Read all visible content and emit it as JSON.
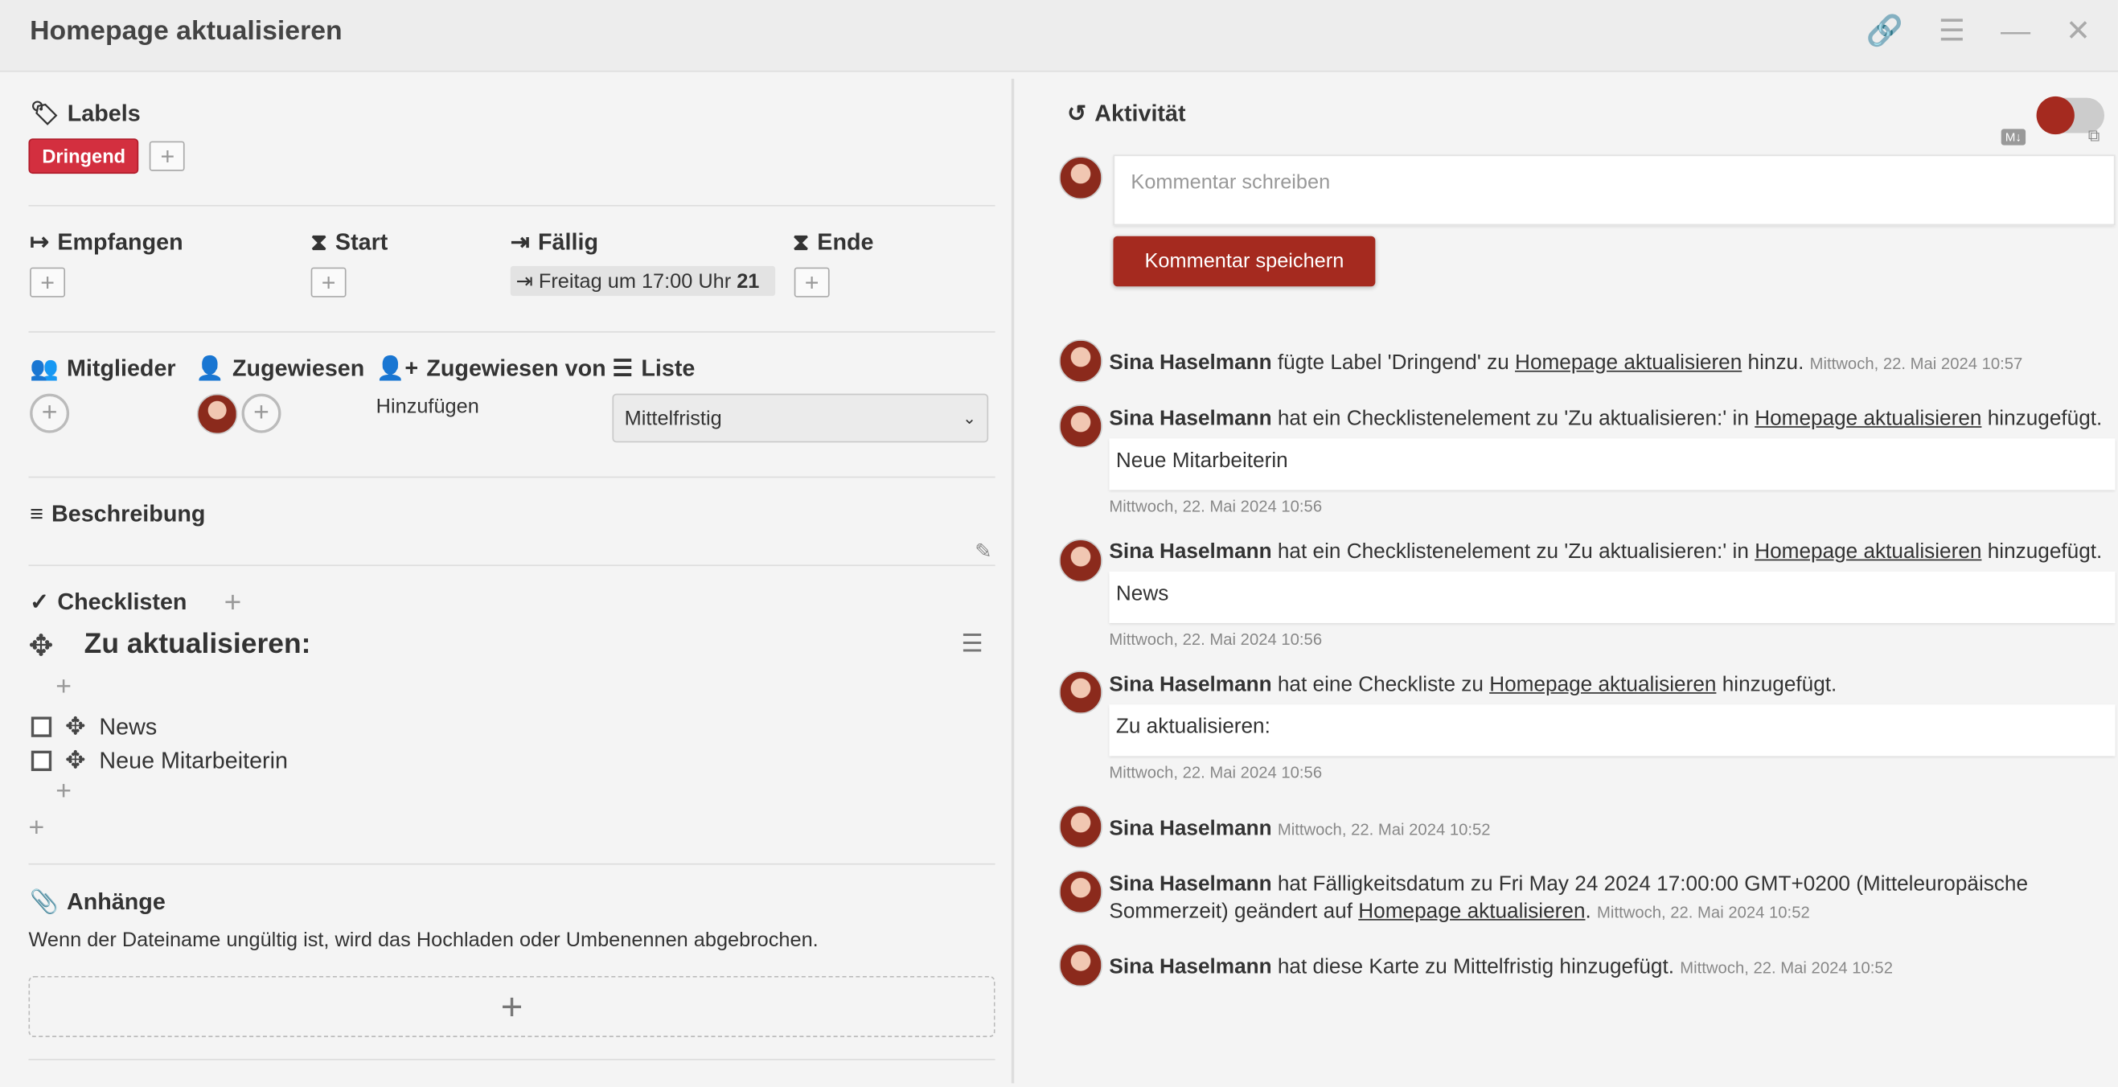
{
  "header": {
    "title": "Homepage aktualisieren"
  },
  "labels": {
    "title": "Labels",
    "items": [
      "Dringend"
    ]
  },
  "dates": {
    "received": "Empfangen",
    "start": "Start",
    "due": "Fällig",
    "due_value_prefix": "Freitag um 17:00 Uhr",
    "due_value_day": "21",
    "end": "Ende"
  },
  "people": {
    "members": "Mitglieder",
    "assigned": "Zugewiesen",
    "assigned_by": "Zugewiesen von",
    "assigned_by_value": "Hinzufügen",
    "list": "Liste",
    "list_value": "Mittelfristig"
  },
  "description": {
    "title": "Beschreibung"
  },
  "checklists": {
    "title": "Checklisten",
    "list_title": "Zu aktualisieren:",
    "items": [
      "News",
      "Neue Mitarbeiterin"
    ]
  },
  "attachments": {
    "title": "Anhänge",
    "note": "Wenn der Dateiname ungültig ist, wird das Hochladen oder Umbenennen abgebrochen."
  },
  "activity": {
    "title": "Aktivität",
    "md_badge": "M↓",
    "comment_placeholder": "Kommentar schreiben",
    "save_label": "Kommentar speichern",
    "entries": [
      {
        "user": "Sina Haselmann",
        "text1": " fügte Label 'Dringend' zu ",
        "link": "Homepage aktualisieren",
        "text2": " hinzu. ",
        "ts": "Mittwoch, 22. Mai 2024 10:57"
      },
      {
        "user": "Sina Haselmann",
        "text1": " hat ein Checklistenelement zu 'Zu aktualisieren:' in ",
        "link": "Homepage aktualisieren",
        "text2": " hinzugefügt.",
        "quote": "Neue Mitarbeiterin",
        "ts": "Mittwoch, 22. Mai 2024 10:56"
      },
      {
        "user": "Sina Haselmann",
        "text1": " hat ein Checklistenelement zu 'Zu aktualisieren:' in ",
        "link": "Homepage aktualisieren",
        "text2": " hinzugefügt.",
        "quote": "News",
        "ts": "Mittwoch, 22. Mai 2024 10:56"
      },
      {
        "user": "Sina Haselmann",
        "text1": " hat eine Checkliste zu ",
        "link": "Homepage aktualisieren",
        "text2": " hinzugefügt.",
        "quote": "Zu aktualisieren:",
        "ts": "Mittwoch, 22. Mai 2024 10:56"
      },
      {
        "user": "Sina Haselmann",
        "ts": "Mittwoch, 22. Mai 2024 10:52"
      },
      {
        "user": "Sina Haselmann",
        "text1": " hat Fälligkeitsdatum zu Fri May 24 2024 17:00:00 GMT+0200 (Mitteleuropäische Sommerzeit) geändert auf ",
        "link": "Homepage aktualisieren",
        "text2": ". ",
        "ts": "Mittwoch, 22. Mai 2024 10:52"
      },
      {
        "user": "Sina Haselmann",
        "text1": " hat diese Karte zu Mittelfristig hinzugefügt. ",
        "ts": "Mittwoch, 22. Mai 2024 10:52"
      }
    ]
  },
  "colors": {
    "accent": "#a52a1f",
    "label_red": "#d32f3f"
  }
}
